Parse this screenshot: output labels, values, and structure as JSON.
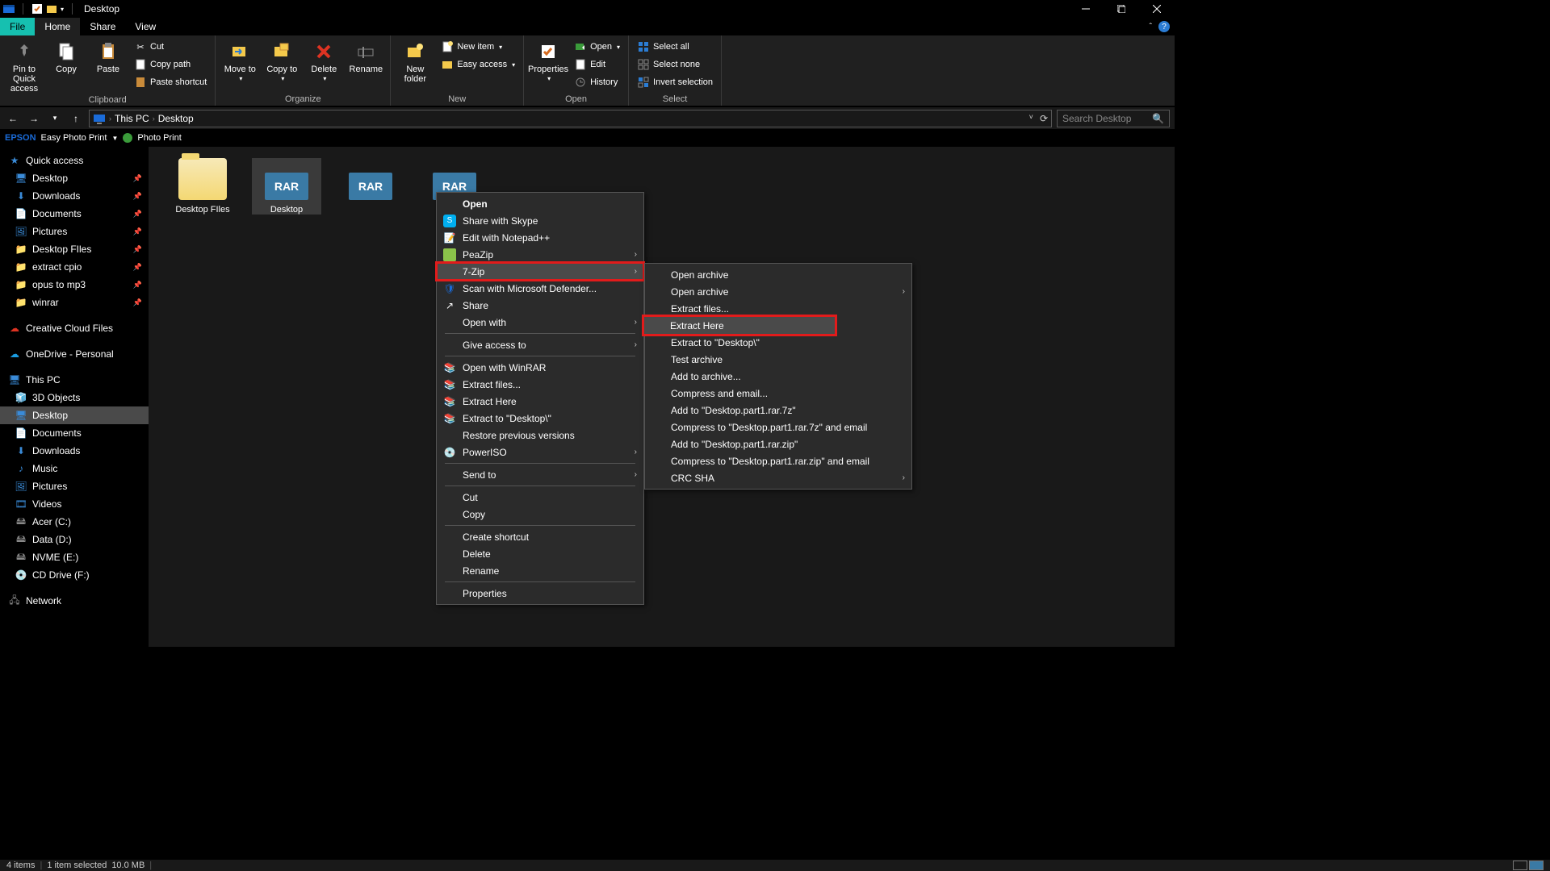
{
  "title_bar": {
    "title": "Desktop"
  },
  "ribbon_tabs": {
    "file": "File",
    "home": "Home",
    "share": "Share",
    "view": "View"
  },
  "ribbon": {
    "clipboard": {
      "label": "Clipboard",
      "pin": "Pin to Quick access",
      "copy": "Copy",
      "paste": "Paste",
      "cut": "Cut",
      "copy_path": "Copy path",
      "paste_shortcut": "Paste shortcut"
    },
    "organize": {
      "label": "Organize",
      "move": "Move to",
      "copy": "Copy to",
      "delete": "Delete",
      "rename": "Rename"
    },
    "new": {
      "label": "New",
      "new_folder": "New folder",
      "new_item": "New item",
      "easy_access": "Easy access"
    },
    "open": {
      "label": "Open",
      "properties": "Properties",
      "open": "Open",
      "edit": "Edit",
      "history": "History"
    },
    "select": {
      "label": "Select",
      "select_all": "Select all",
      "select_none": "Select none",
      "invert": "Invert selection"
    }
  },
  "breadcrumb": {
    "root": "This PC",
    "leaf": "Desktop"
  },
  "search": {
    "placeholder": "Search Desktop"
  },
  "epson": {
    "brand": "EPSON",
    "easy": "Easy Photo Print",
    "photo": "Photo Print"
  },
  "sidebar": {
    "quick": "Quick access",
    "pinned": [
      "Desktop",
      "Downloads",
      "Documents",
      "Pictures",
      "Desktop FIles",
      "extract cpio",
      "opus to mp3",
      "winrar"
    ],
    "creative": "Creative Cloud Files",
    "onedrive": "OneDrive - Personal",
    "thispc": "This PC",
    "pcitems": [
      "3D Objects",
      "Desktop",
      "Documents",
      "Downloads",
      "Music",
      "Pictures",
      "Videos",
      "Acer (C:)",
      "Data (D:)",
      "NVME (E:)",
      "CD Drive (F:)"
    ],
    "network": "Network"
  },
  "files": {
    "items": [
      {
        "name": "Desktop FIles",
        "type": "folder"
      },
      {
        "name": "Desktop",
        "type": "rar",
        "selected": true
      },
      {
        "name": "",
        "type": "rar"
      },
      {
        "name": "",
        "type": "rar"
      }
    ]
  },
  "context_menu": {
    "open": "Open",
    "skype": "Share with Skype",
    "notepad": "Edit with Notepad++",
    "peazip": "PeaZip",
    "sevenzip": "7-Zip",
    "defender": "Scan with Microsoft Defender...",
    "share": "Share",
    "open_with": "Open with",
    "give_access": "Give access to",
    "winrar": "Open with WinRAR",
    "extract_files": "Extract files...",
    "extract_here": "Extract Here",
    "extract_to": "Extract to \"Desktop\\\"",
    "restore": "Restore previous versions",
    "poweriso": "PowerISO",
    "send_to": "Send to",
    "cut": "Cut",
    "copy": "Copy",
    "create_shortcut": "Create shortcut",
    "delete": "Delete",
    "rename": "Rename",
    "properties": "Properties"
  },
  "submenu": {
    "open_archive1": "Open archive",
    "open_archive2": "Open archive",
    "extract_files": "Extract files...",
    "extract_here": "Extract Here",
    "extract_to": "Extract to \"Desktop\\\"",
    "test": "Test archive",
    "add": "Add to archive...",
    "compress_email": "Compress and email...",
    "add_7z": "Add to \"Desktop.part1.rar.7z\"",
    "compress_7z": "Compress to \"Desktop.part1.rar.7z\" and email",
    "add_zip": "Add to \"Desktop.part1.rar.zip\"",
    "compress_zip": "Compress to \"Desktop.part1.rar.zip\" and email",
    "crc": "CRC SHA"
  },
  "status": {
    "items": "4 items",
    "selected": "1 item selected",
    "size": "10.0 MB"
  }
}
